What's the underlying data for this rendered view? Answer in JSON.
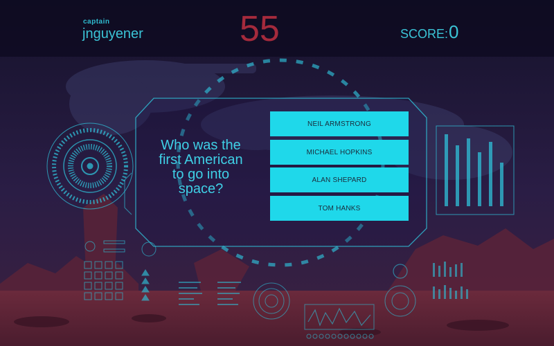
{
  "header": {
    "captain_label": "captain",
    "captain_name": "jnguyener",
    "timer": "55",
    "score_label": "SCORE:",
    "score_value": "0"
  },
  "question": {
    "lines": [
      "Who was the",
      "first American",
      "to go into",
      "space?"
    ]
  },
  "answers": [
    {
      "label": "NEIL ARMSTRONG"
    },
    {
      "label": "MICHAEL HOPKINS"
    },
    {
      "label": "ALAN SHEPARD"
    },
    {
      "label": "TOM HANKS"
    }
  ],
  "theme": {
    "accent": "#1fd8ea",
    "timer_color": "#a52a3c",
    "background": "#1a1530"
  }
}
